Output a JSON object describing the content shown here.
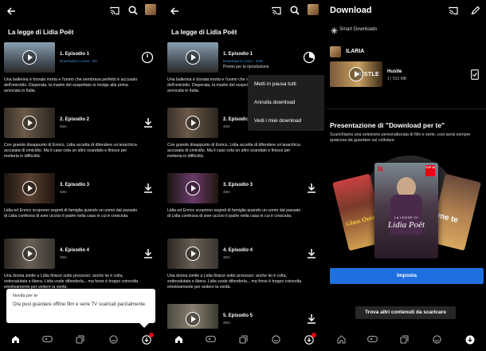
{
  "screen1": {
    "show_title": "La legge di Lidia Poët",
    "episodes": [
      {
        "title": "1. Episodio 1",
        "sub": "Download in corso - 8%",
        "desc": "Una ballerina è trovata morta e l'uomo che sembrava perfetto è accusato dell'omicidio. Disperata, la madre del sospettato si rivolge alla prima avvocata in Italia."
      },
      {
        "title": "2. Episodio 2",
        "sub": "40m",
        "desc": "Con grande disappunto di Enrico, Lidia accetta di difendere un'anarchica accusata di omicidio. Ma il caso cela un altro scandalo e finisce per metterla in difficoltà."
      },
      {
        "title": "3. Episodio 3",
        "sub": "40m",
        "desc": "Lidia ed Enrico scoprono segreti di famiglia quando un uomo dal passato di Lidia confessa di aver ucciso il padre nella casa in cui è cresciuta."
      },
      {
        "title": "4. Episodio 4",
        "sub": "40m",
        "desc": "Una donna simile a Lidia finisce sotto processo: anche lei è colta, sottovalutata e libera. Lidia vuole difenderla... ma forse è troppo coinvolta emotivamente per vedere la verità."
      }
    ],
    "toast": {
      "title": "Novità per te",
      "message": "Ora puoi guardare offline film e serie TV scaricati parzialmente."
    }
  },
  "screen2": {
    "show_title": "La legge di Lidia Poët",
    "episodes": [
      {
        "title": "1. Episodio 1",
        "sub": "Download in corso - 34%",
        "sub2": "Pronto per la riproduzione",
        "desc": "Una ballerina è trovata morta e l'uomo che sembrava perfetto è accusato dell'omicidio. Disperata, la madre del sospettato si rivolge alla prima avvocata in Italia."
      },
      {
        "title": "2. Episodio 2",
        "sub": "40m",
        "desc": "Con grande disappunto di Enrico, Lidia accetta di difendere un'anarchica accusata di omicidio. Ma il caso cela un altro scandalo e finisce per metterla in difficoltà."
      },
      {
        "title": "3. Episodio 3",
        "sub": "40m",
        "desc": "Lidia ed Enrico scoprono segreti di famiglia quando un uomo dal passato di Lidia confessa di aver ucciso il padre nella casa in cui è cresciuta."
      },
      {
        "title": "4. Episodio 4",
        "sub": "40m",
        "desc": "Una donna simile a Lidia finisce sotto processo: anche lei è colta, sottovalutata e libera. Lidia vuole difenderla... ma forse è troppo coinvolta emotivamente per vedere la verità."
      },
      {
        "title": "5. Episodio 5",
        "sub": "40m",
        "desc": ""
      }
    ],
    "menu": [
      "Metti in pausa tutti",
      "Annulla download",
      "Vedi i miei download"
    ]
  },
  "screen3": {
    "title": "Download",
    "smart_downloads": "Smart Downloads",
    "profile": "ILARIA",
    "movie": {
      "title": "Hustle",
      "sub": "1 | 513 MB",
      "thumb_text": "HUSTLE"
    },
    "promo_title": "Presentazione di \"Download per te\"",
    "promo_desc": "Scarichiamo una selezione personalizzata di film e serie, così avrai sempre qualcosa da guardare sul cellulare.",
    "poster_texts": {
      "center": "Lidia Poët",
      "center_top": "LA LEGGE DI",
      "left": "Glass Onion",
      "right": "me te",
      "top10": "TOP 10"
    },
    "imposta": "Imposta",
    "more": "Trova altri contenuti da scaricare"
  },
  "icons": [
    "back-arrow-icon",
    "cast-icon",
    "search-icon",
    "download-icon",
    "home-icon",
    "games-icon",
    "new-hot-icon",
    "fast-laughs-icon",
    "pencil-icon",
    "sparkle-icon",
    "check-phone-icon",
    "progress-ring-icon"
  ],
  "progress": {
    "screen1_episode1": 0.08,
    "screen2_episode1": 0.34
  },
  "colors": {
    "brand_red": "#e50914",
    "accent_blue": "#1f6fe0",
    "progress_blue": "#4a90d9"
  }
}
